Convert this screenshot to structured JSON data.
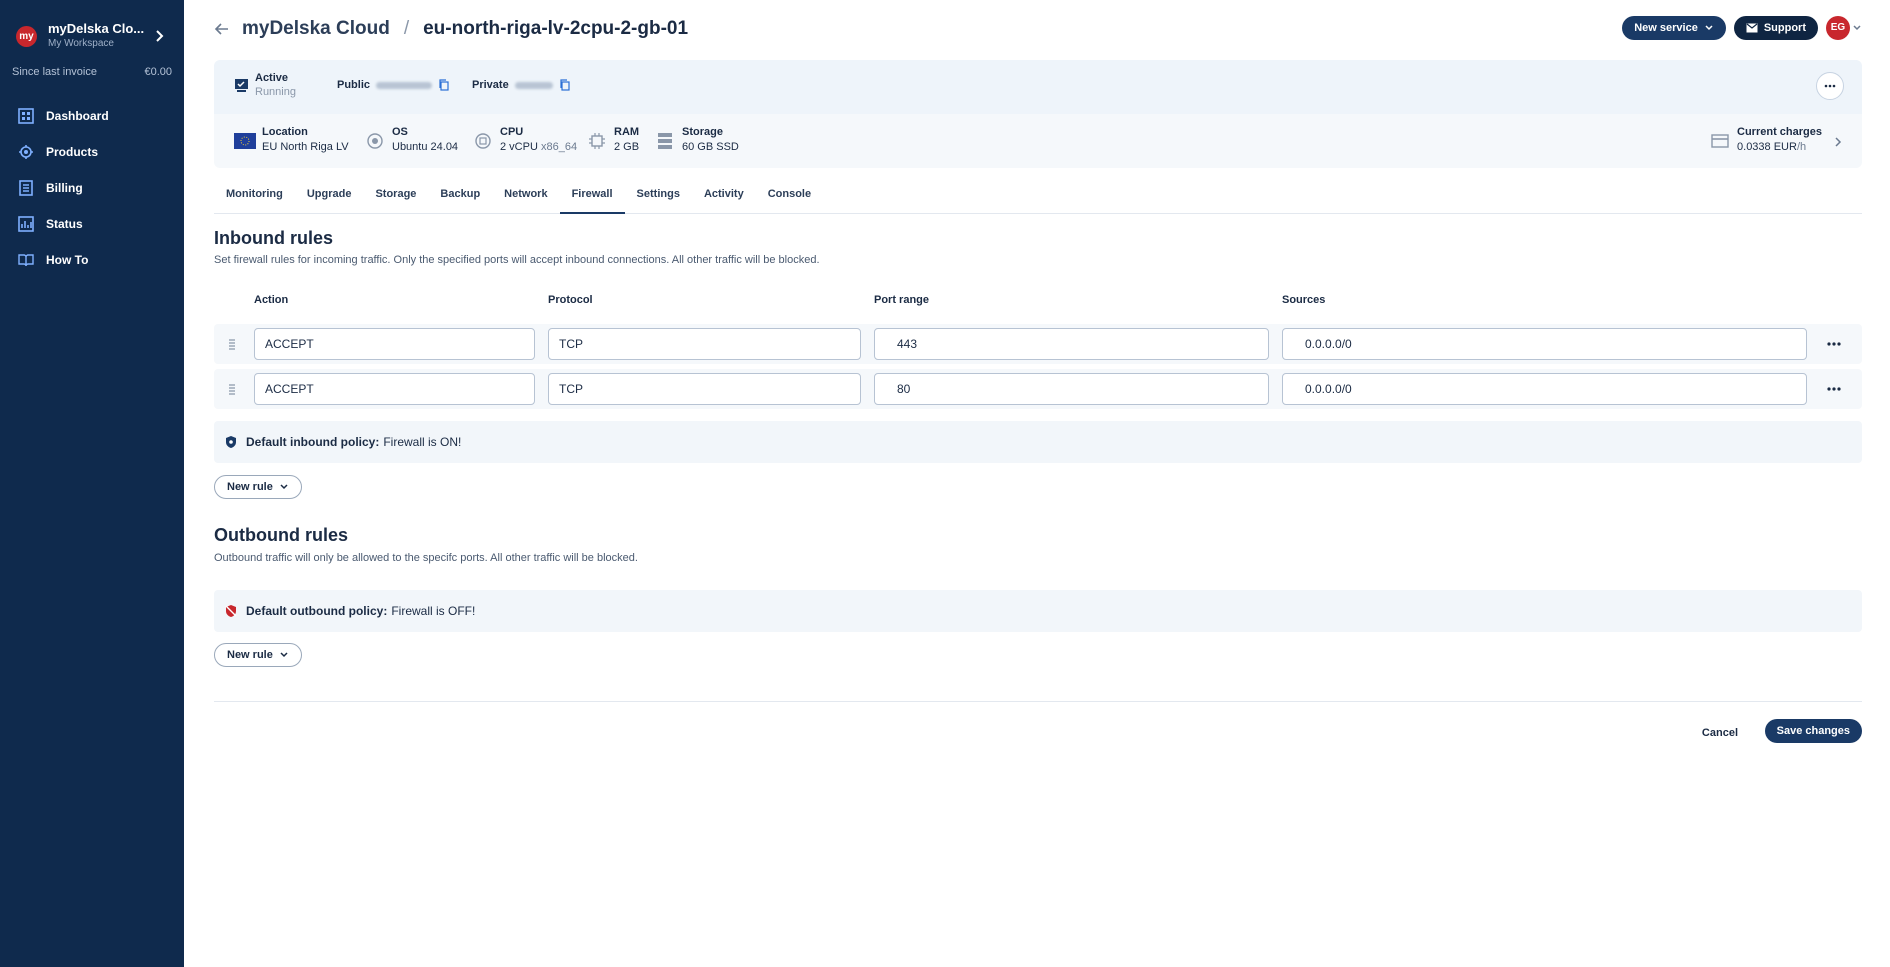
{
  "sidebar": {
    "workspace": {
      "avatar": "my",
      "name": "myDelska Clo...",
      "sub": "My Workspace"
    },
    "invoice": {
      "label": "Since last invoice",
      "value": "€0.00"
    },
    "items": [
      {
        "label": "Dashboard",
        "icon": "dashboard-icon"
      },
      {
        "label": "Products",
        "icon": "products-icon"
      },
      {
        "label": "Billing",
        "icon": "billing-icon"
      },
      {
        "label": "Status",
        "icon": "status-icon"
      },
      {
        "label": "How To",
        "icon": "book-icon"
      }
    ]
  },
  "header": {
    "title": "myDelska Cloud",
    "separator": "/",
    "server": "eu-north-riga-lv-2cpu-2-gb-01",
    "new_service": "New service",
    "support": "Support",
    "user_initials": "EG"
  },
  "status": {
    "state": "Active",
    "sub": "Running",
    "public_label": "Public",
    "private_label": "Private"
  },
  "specs": {
    "location": {
      "label": "Location",
      "value": "EU North Riga LV"
    },
    "os": {
      "label": "OS",
      "value": "Ubuntu 24.04"
    },
    "cpu": {
      "label": "CPU",
      "value": "2 vCPU",
      "extra": "x86_64"
    },
    "ram": {
      "label": "RAM",
      "value": "2 GB"
    },
    "storage": {
      "label": "Storage",
      "value": "60 GB SSD"
    },
    "charges": {
      "label": "Current charges",
      "value": "0.0338 EUR",
      "unit": "/h"
    }
  },
  "tabs": [
    "Monitoring",
    "Upgrade",
    "Storage",
    "Backup",
    "Network",
    "Firewall",
    "Settings",
    "Activity",
    "Console"
  ],
  "active_tab": "Firewall",
  "inbound": {
    "title": "Inbound rules",
    "desc": "Set firewall rules for incoming traffic. Only the specified ports will accept inbound connections. All other traffic will be blocked.",
    "columns": {
      "action": "Action",
      "protocol": "Protocol",
      "port": "Port range",
      "sources": "Sources"
    },
    "rules": [
      {
        "action": "ACCEPT",
        "protocol": "TCP",
        "port": "443",
        "source": "0.0.0.0/0"
      },
      {
        "action": "ACCEPT",
        "protocol": "TCP",
        "port": "80",
        "source": "0.0.0.0/0"
      }
    ],
    "policy_label": "Default inbound policy:",
    "policy_value": "Firewall is ON!",
    "new_rule": "New rule"
  },
  "outbound": {
    "title": "Outbound rules",
    "desc": "Outbound traffic will only be allowed to the specifc ports. All other traffic will be blocked.",
    "policy_label": "Default outbound policy:",
    "policy_value": "Firewall is OFF!",
    "new_rule": "New rule"
  },
  "footer": {
    "cancel": "Cancel",
    "save": "Save changes"
  },
  "colors": {
    "sidebar": "#0f2a4d",
    "primary": "#1a3a66",
    "brand_red": "#c8272d",
    "shield_on": "#1a3a66",
    "shield_off": "#c8272d"
  }
}
